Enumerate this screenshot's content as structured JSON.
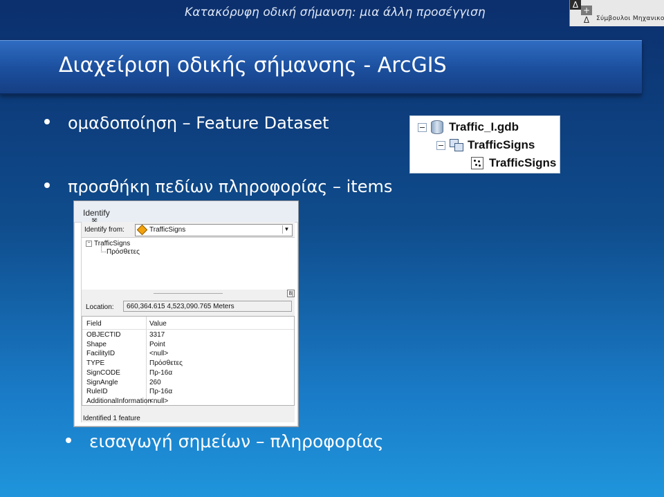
{
  "header": {
    "caption": "Κατακόρυφη οδική σήμανση: μια άλλη προσέγγιση",
    "logo": {
      "letters": [
        "Δ",
        "+",
        "Δ"
      ],
      "text": "Σύμβουλοι Μηχανικοί"
    }
  },
  "slide": {
    "title": "Διαχείριση οδικής σήμανσης - ArcGIS",
    "bullets": [
      "ομαδοποίηση – Feature Dataset",
      "προσθήκη πεδίων πληροφορίας – items",
      "εισαγωγή σημείων – πληροφορίας"
    ]
  },
  "catalog_tree": {
    "geodatabase": "Traffic_I.gdb",
    "feature_dataset": "TrafficSigns",
    "feature_class": "TrafficSigns",
    "icons": [
      "database-icon",
      "feature-dataset-icon",
      "point-feature-class-icon"
    ]
  },
  "identify": {
    "title": "Identify",
    "from_label": "Identify from:",
    "from_value": "TrafficSigns",
    "tree": {
      "layer": "TrafficSigns",
      "feature": "Πρόσθετες"
    },
    "location_label": "Location:",
    "location_value": "660,364.615  4,523,090.765 Meters",
    "columns": [
      "Field",
      "Value"
    ],
    "rows": [
      {
        "field": "OBJECTID",
        "value": "3317"
      },
      {
        "field": "Shape",
        "value": "Point"
      },
      {
        "field": "FacilityID",
        "value": "<null>"
      },
      {
        "field": "TYPE",
        "value": "Πρόσθετες"
      },
      {
        "field": "SignCODE",
        "value": "Πρ-16α"
      },
      {
        "field": "SignAngle",
        "value": "260"
      },
      {
        "field": "RuleID",
        "value": "Πρ-16α"
      },
      {
        "field": "AdditionalInformation",
        "value": "<null>"
      }
    ],
    "status": "Identified 1 feature"
  }
}
